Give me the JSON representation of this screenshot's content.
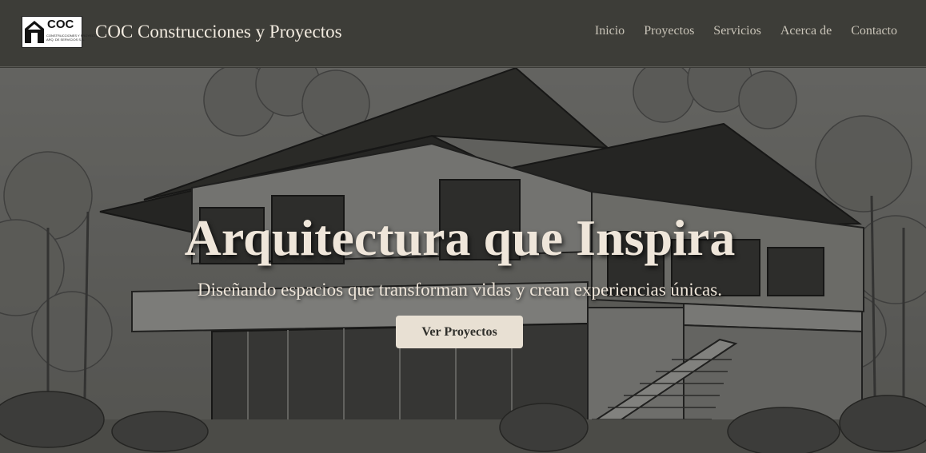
{
  "header": {
    "logo": {
      "abbr": "COC",
      "line1": "CONSTRUCCIONES Y PROYECTOS",
      "line2": "ARQ. DE SERVICIOS S.A."
    },
    "brand": "COC Construcciones y Proyectos",
    "nav": [
      "Inicio",
      "Proyectos",
      "Servicios",
      "Acerca de",
      "Contacto"
    ]
  },
  "hero": {
    "title": "Arquitectura que Inspira",
    "subtitle": "Diseñando espacios que transforman vidas y crean experiencias únicas.",
    "cta_label": "Ver Proyectos"
  },
  "colors": {
    "header_bg": "#3d3d38",
    "text_light": "#efe6da",
    "nav_text": "#c9c4b8",
    "button_bg": "#e8e0d3",
    "button_text": "#2f2f2b"
  }
}
